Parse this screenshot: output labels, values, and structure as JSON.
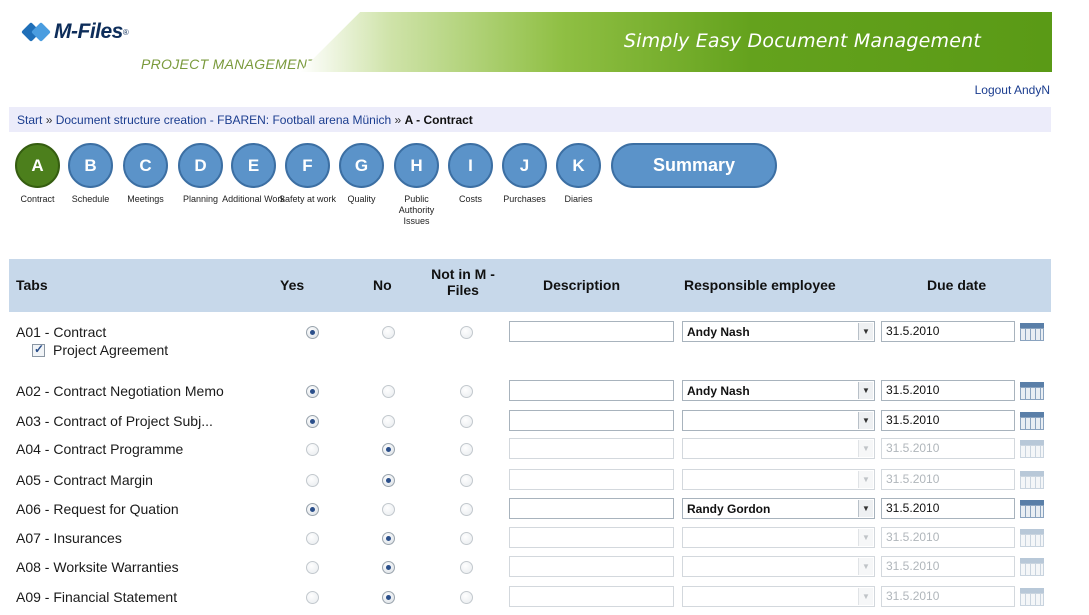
{
  "header": {
    "logo_text": "M-Files",
    "logo_reg": "®",
    "product_name": "PROJECT MANAGEMENT",
    "tagline": "Simply Easy Document Management",
    "logout_label": "Logout AndyN"
  },
  "breadcrumb": {
    "start": "Start",
    "separator": "»",
    "parent": "Document structure creation - FBAREN: Football arena Münich",
    "current": "A - Contract"
  },
  "steps": [
    {
      "letter": "A",
      "label": "Contract",
      "active": true
    },
    {
      "letter": "B",
      "label": "Schedule",
      "active": false
    },
    {
      "letter": "C",
      "label": "Meetings",
      "active": false
    },
    {
      "letter": "D",
      "label": "Planning",
      "active": false
    },
    {
      "letter": "E",
      "label": "Additional Work",
      "active": false
    },
    {
      "letter": "F",
      "label": "Safety at work",
      "active": false
    },
    {
      "letter": "G",
      "label": "Quality",
      "active": false
    },
    {
      "letter": "H",
      "label": "Public Authority Issues",
      "active": false
    },
    {
      "letter": "I",
      "label": "Costs",
      "active": false
    },
    {
      "letter": "J",
      "label": "Purchases",
      "active": false
    },
    {
      "letter": "K",
      "label": "Diaries",
      "active": false
    }
  ],
  "summary_label": "Summary",
  "table": {
    "headers": {
      "tabs": "Tabs",
      "yes": "Yes",
      "no": "No",
      "not_in_mfiles": "Not in M -Files",
      "description": "Description",
      "responsible": "Responsible employee",
      "due": "Due date"
    },
    "rows": [
      {
        "name": "A01 - Contract",
        "choice": "yes",
        "description": "",
        "employee": "Andy Nash",
        "due": "31.5.2010"
      },
      {
        "name": "A02 - Contract Negotiation Memo",
        "choice": "yes",
        "description": "",
        "employee": "Andy Nash",
        "due": "31.5.2010"
      },
      {
        "name": "A03 - Contract of Project Subj...",
        "choice": "yes",
        "description": "",
        "employee": "",
        "due": "31.5.2010"
      },
      {
        "name": "A04 - Contract Programme",
        "choice": "no",
        "description": "",
        "employee": "",
        "due": "31.5.2010"
      },
      {
        "name": "A05 - Contract Margin",
        "choice": "no",
        "description": "",
        "employee": "",
        "due": "31.5.2010"
      },
      {
        "name": "A06 - Request for Quation",
        "choice": "yes",
        "description": "",
        "employee": "Randy Gordon",
        "due": "31.5.2010"
      },
      {
        "name": "A07 - Insurances",
        "choice": "no",
        "description": "",
        "employee": "",
        "due": "31.5.2010"
      },
      {
        "name": "A08 - Worksite Warranties",
        "choice": "no",
        "description": "",
        "employee": "",
        "due": "31.5.2010"
      },
      {
        "name": "A09 - Financial Statement",
        "choice": "no",
        "description": "",
        "employee": "",
        "due": "31.5.2010"
      }
    ],
    "sub_item": {
      "label": "Project Agreement",
      "checked": true
    }
  }
}
